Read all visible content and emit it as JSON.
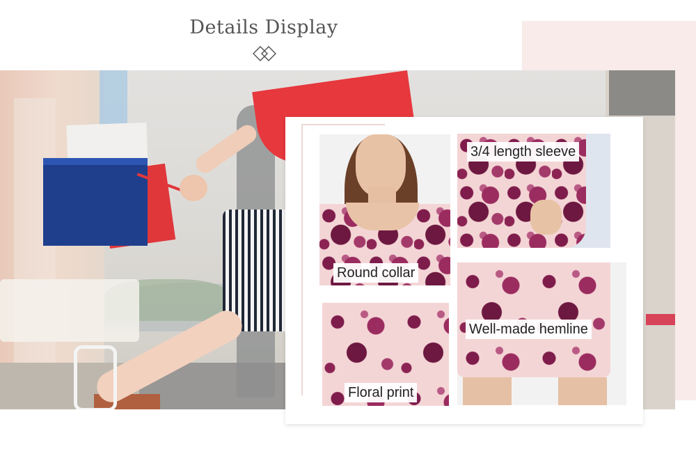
{
  "header": {
    "title": "Details Display",
    "icon": "double-diamond-icon"
  },
  "colors": {
    "accent_pink": "#f8ebe9",
    "floral_base": "#f4d5d6",
    "floral_plum": "#7e1c4b"
  },
  "details": [
    {
      "label": "Round collar"
    },
    {
      "label": "3/4 length sleeve"
    },
    {
      "label": "Floral print"
    },
    {
      "label": "Well-made hemline"
    }
  ]
}
